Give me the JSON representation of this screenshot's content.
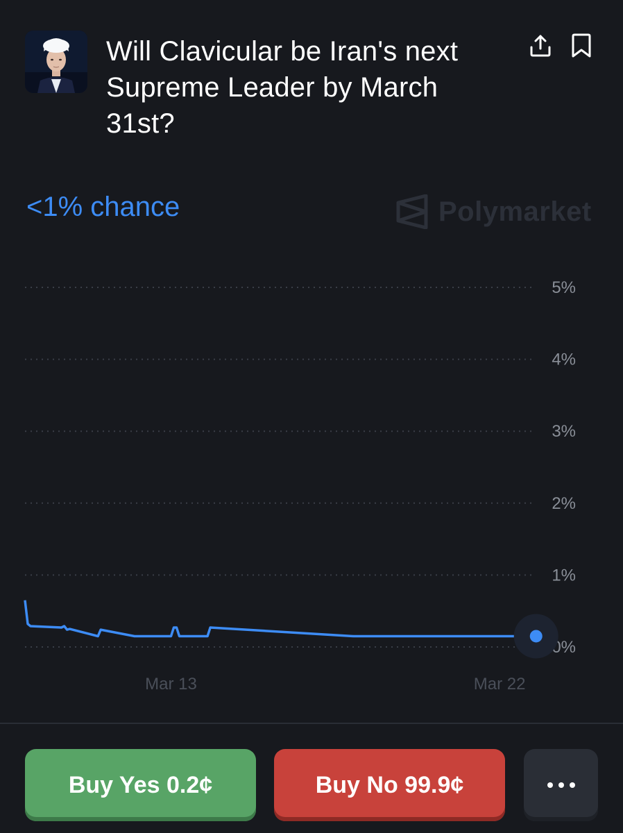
{
  "market": {
    "title": "Will Clavicular be Iran's next Supreme Leader by March 31st?",
    "chance_text": "<1% chance",
    "brand": "Polymarket",
    "icons": {
      "share": "share-icon",
      "bookmark": "bookmark-icon",
      "brand": "polymarket-logo-icon",
      "more": "more-horizontal-icon"
    }
  },
  "chart_data": {
    "type": "line",
    "title": "",
    "xlabel": "",
    "ylabel": "",
    "x_ticks": [
      "Mar 13",
      "Mar 22"
    ],
    "y_ticks": [
      "0%",
      "1%",
      "2%",
      "3%",
      "4%",
      "5%"
    ],
    "ylim": [
      0,
      5
    ],
    "grid": true,
    "color": "#3d8cf5",
    "series": [
      {
        "x": [
          "Mar 9",
          "Mar 9",
          "Mar 9",
          "Mar 10",
          "Mar 10",
          "Mar 10",
          "Mar 10",
          "Mar 11",
          "Mar 11",
          "Mar 12",
          "Mar 12",
          "Mar 13",
          "Mar 13",
          "Mar 13",
          "Mar 13",
          "Mar 14",
          "Mar 14",
          "Mar 18",
          "Mar 22",
          "Mar 23"
        ],
        "y": [
          0.65,
          0.32,
          0.29,
          0.27,
          0.29,
          0.24,
          0.25,
          0.15,
          0.24,
          0.15,
          0.15,
          0.15,
          0.27,
          0.27,
          0.15,
          0.15,
          0.27,
          0.15,
          0.15,
          0.15
        ]
      }
    ]
  },
  "actions": {
    "buy_yes": "Buy Yes 0.2¢",
    "buy_no": "Buy No 99.9¢",
    "more": "···"
  },
  "colors": {
    "background": "#17191e",
    "accent": "#3d8cf5",
    "yes": "#58a466",
    "no": "#c8423b"
  }
}
